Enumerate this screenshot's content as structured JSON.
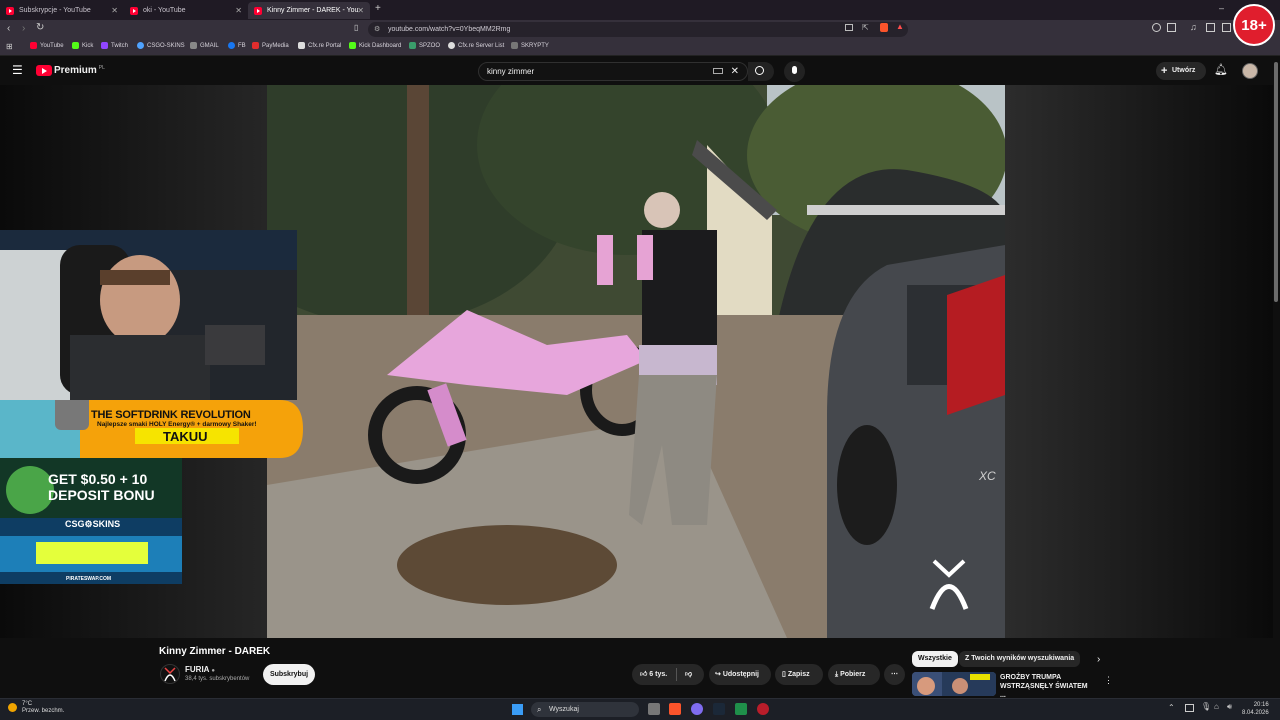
{
  "browser": {
    "tabs": [
      {
        "title": "Subskrypcje - YouTube"
      },
      {
        "title": "oki - YouTube"
      },
      {
        "title": "Kinny Zimmer - DAREK - You"
      }
    ],
    "new_tab_label": "+",
    "url": "youtube.com/watch?v=0YbeqMM2Rmg",
    "bookmarks": [
      "YouTube",
      "Kick",
      "Twitch",
      "CSGO-SKINS",
      "GMAIL",
      "FB",
      "PayMedia",
      "Cfx.re Portal",
      "Kick Dashboard",
      "SPZOO",
      "Cfx.re Server List",
      "SKRYPTY"
    ],
    "age_badge": "18+"
  },
  "youtube": {
    "logo": "Premium",
    "logo_region": "PL",
    "search_query": "kinny zimmer",
    "create_label": "Utwórz"
  },
  "overlay": {
    "sponsor1_headline": "THE SOFTDRINK REVOLUTION",
    "sponsor1_sub": "Najlepsze smaki HOLY Energy® + darmowy Shaker!",
    "sponsor1_code": "TAKUU",
    "sponsor2_headline_1": "GET $0.50 + 10",
    "sponsor2_headline_2": "DEPOSIT BONU",
    "sponsor2_brand": "CSG⚙SKINS",
    "sponsor2_footer": "PIRATESWAP.COM"
  },
  "video": {
    "title": "Kinny Zimmer - DAREK",
    "channel": "FURIA",
    "subscribers": "38,4 tys. subskrybentów",
    "subscribe_label": "Subskrybuj",
    "likes": "6 tys.",
    "share_label": "Udostępnij",
    "save_label": "Zapisz",
    "download_label": "Pobierz",
    "car_badge": "XC"
  },
  "sidebar": {
    "chips": [
      "Wszystkie",
      "Z Twoich wyników wyszukiwania"
    ],
    "rec_title": "GROŹBY TRUMPA WSTRZĄSNĘŁY ŚWIATEM ..."
  },
  "taskbar": {
    "weather_temp": "7°C",
    "weather_desc": "Przew. bezchm.",
    "search_label": "Wyszukaj",
    "time": "20:16",
    "date": "8.04.2026"
  }
}
